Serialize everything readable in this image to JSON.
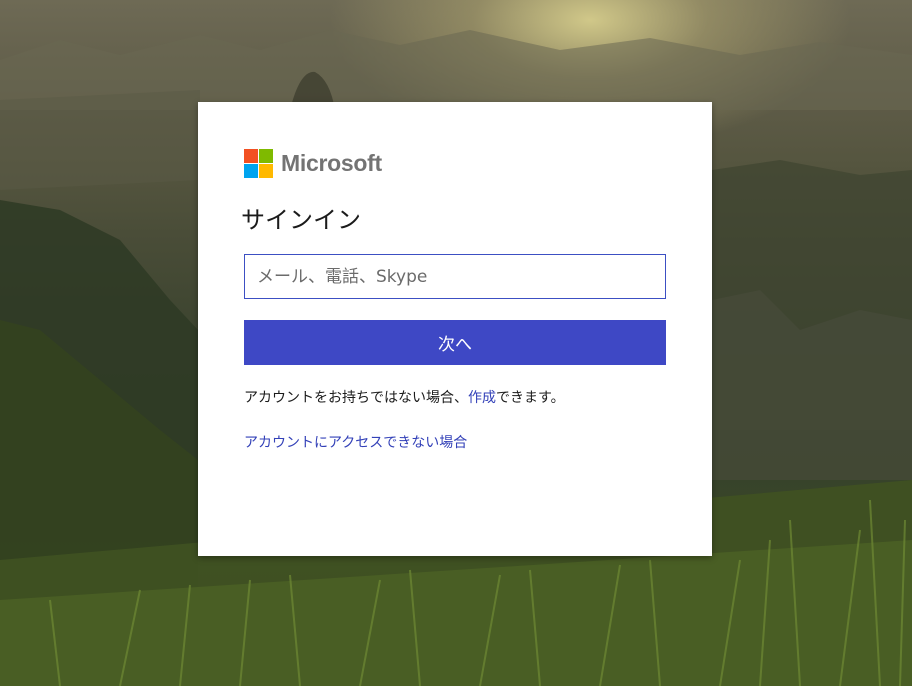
{
  "brand": {
    "name": "Microsoft",
    "logo_colors": [
      "#f25022",
      "#7fba00",
      "#00a4ef",
      "#ffb900"
    ]
  },
  "signin": {
    "title": "サインイン",
    "input_placeholder": "メール、電話、Skype",
    "input_value": "",
    "next_button": "次へ",
    "no_account_prefix": "アカウントをお持ちではない場合、",
    "create_link": "作成",
    "no_account_suffix": "できます。",
    "cant_access_link": "アカウントにアクセスできない場合"
  },
  "colors": {
    "accent": "#3e48c5",
    "link": "#3341b8",
    "input_border": "#3c4fc3"
  }
}
